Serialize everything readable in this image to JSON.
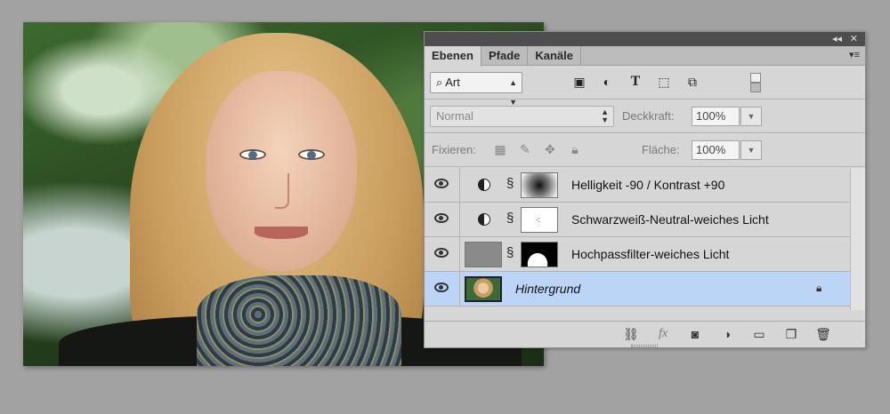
{
  "panel": {
    "collapse": "◂◂",
    "close": "✕",
    "tabs": [
      {
        "label": "Ebenen"
      },
      {
        "label": "Pfade"
      },
      {
        "label": "Kanäle"
      }
    ],
    "menu": "▾≡"
  },
  "filter": {
    "value": "Art"
  },
  "blend": {
    "mode": "Normal",
    "opacity_label": "Deckkraft:",
    "opacity_value": "100%"
  },
  "lock": {
    "label": "Fixieren:",
    "fill_label": "Fläche:",
    "fill_value": "100%"
  },
  "layers": [
    {
      "name": "Helligkeit -90 / Kontrast +90",
      "type": "adjustment"
    },
    {
      "name": "Schwarzweiß-Neutral-weiches Licht",
      "type": "adjustment"
    },
    {
      "name": "Hochpassfilter-weiches Licht",
      "type": "pixel-mask"
    },
    {
      "name": "Hintergrund",
      "type": "background",
      "selected": true
    }
  ]
}
